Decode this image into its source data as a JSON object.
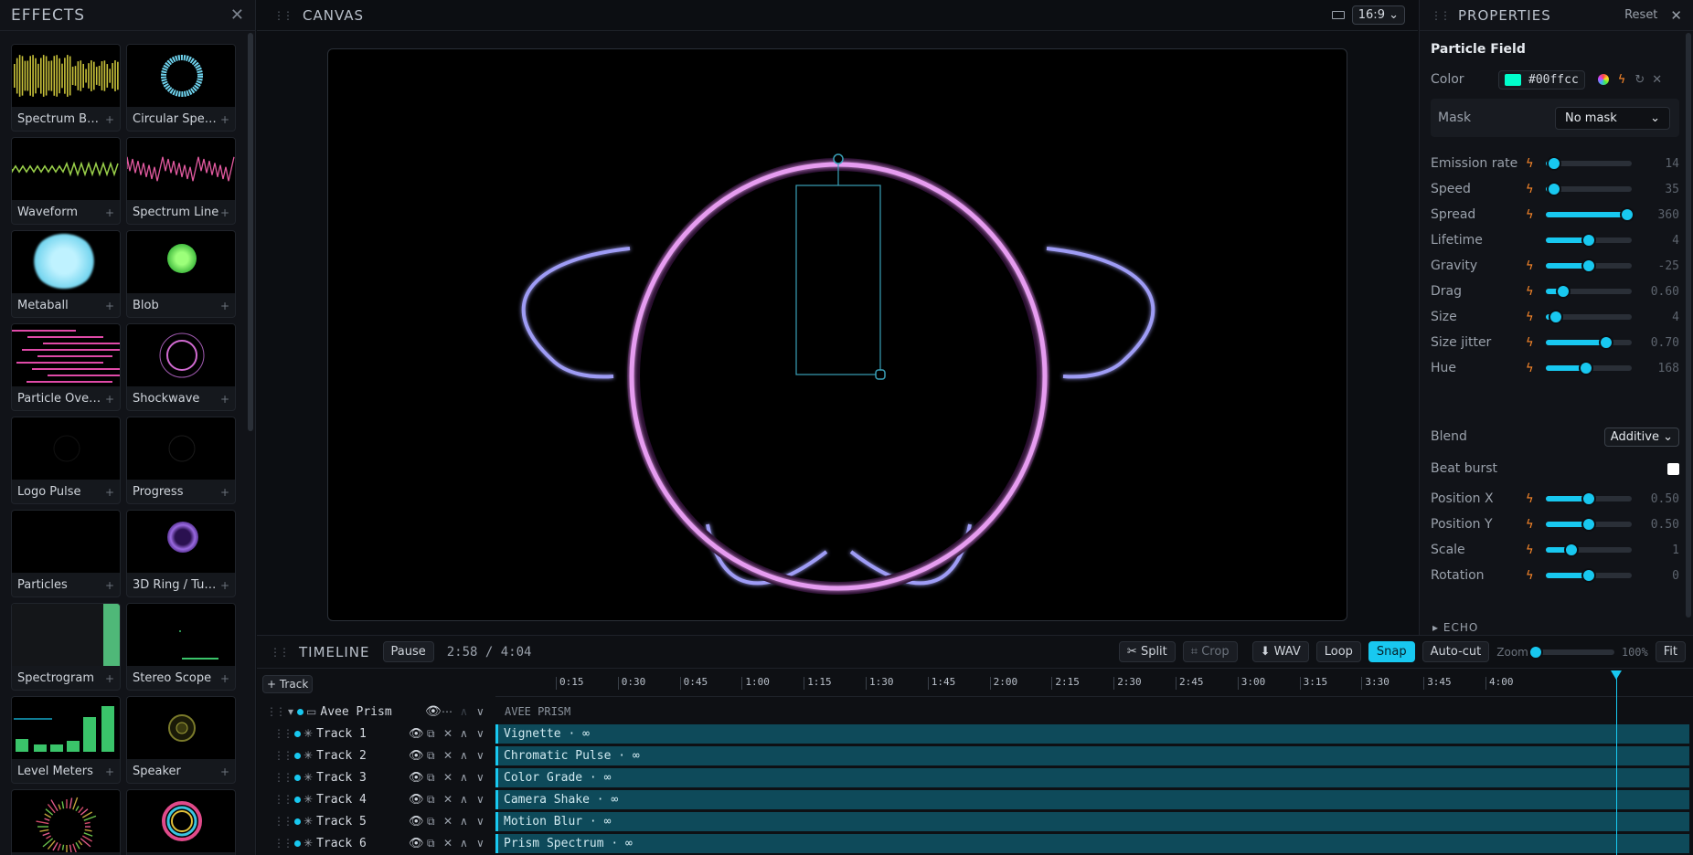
{
  "effects": {
    "title": "EFFECTS",
    "items": [
      {
        "label": "Spectrum Bars",
        "icon": "spectrum-bars-thumb"
      },
      {
        "label": "Circular Spect…",
        "icon": "circular-spectrum-thumb"
      },
      {
        "label": "Waveform",
        "icon": "waveform-thumb"
      },
      {
        "label": "Spectrum Line",
        "icon": "spectrum-line-thumb"
      },
      {
        "label": "Metaball",
        "icon": "metaball-thumb"
      },
      {
        "label": "Blob",
        "icon": "blob-thumb"
      },
      {
        "label": "Particle Overlay",
        "icon": "particle-overlay-thumb"
      },
      {
        "label": "Shockwave",
        "icon": "shockwave-thumb"
      },
      {
        "label": "Logo Pulse",
        "icon": "logo-pulse-thumb"
      },
      {
        "label": "Progress",
        "icon": "progress-thumb"
      },
      {
        "label": "Particles",
        "icon": "particles-thumb"
      },
      {
        "label": "3D Ring / Tun…",
        "icon": "ring-tunnel-thumb"
      },
      {
        "label": "Spectrogram",
        "icon": "spectrogram-thumb"
      },
      {
        "label": "Stereo Scope",
        "icon": "stereo-scope-thumb"
      },
      {
        "label": "Level Meters",
        "icon": "level-meters-thumb"
      },
      {
        "label": "Speaker",
        "icon": "speaker-thumb"
      },
      {
        "label": "",
        "icon": "radial-bars-thumb"
      },
      {
        "label": "",
        "icon": "rainbow-ring-thumb"
      }
    ],
    "add_symbol": "+"
  },
  "canvas": {
    "title": "CANVAS",
    "aspect": "16:9"
  },
  "properties": {
    "title": "PROPERTIES",
    "reset": "Reset",
    "effect_name": "Particle Field",
    "color_label": "Color",
    "color_value": "#00ffcc",
    "mask_label": "Mask",
    "mask_value": "No mask",
    "rows": [
      {
        "label": "Emission rate",
        "value": "14",
        "pos": 0.1,
        "bolt": true
      },
      {
        "label": "Speed",
        "value": "35",
        "pos": 0.1,
        "bolt": true
      },
      {
        "label": "Spread",
        "value": "360",
        "pos": 0.95,
        "bolt": true
      },
      {
        "label": "Lifetime",
        "value": "4",
        "pos": 0.5,
        "bolt": false
      },
      {
        "label": "Gravity",
        "value": "-25",
        "pos": 0.5,
        "bolt": true
      },
      {
        "label": "Drag",
        "value": "0.60",
        "pos": 0.2,
        "bolt": true
      },
      {
        "label": "Size",
        "value": "4",
        "pos": 0.12,
        "bolt": true
      },
      {
        "label": "Size jitter",
        "value": "0.70",
        "pos": 0.7,
        "bolt": true
      },
      {
        "label": "Hue",
        "value": "168",
        "pos": 0.47,
        "bolt": true
      }
    ],
    "blend_label": "Blend",
    "blend_value": "Additive",
    "beat_label": "Beat burst",
    "rows2": [
      {
        "label": "Position X",
        "value": "0.50",
        "pos": 0.5,
        "bolt": true
      },
      {
        "label": "Position Y",
        "value": "0.50",
        "pos": 0.5,
        "bolt": true
      },
      {
        "label": "Scale",
        "value": "1",
        "pos": 0.3,
        "bolt": true
      },
      {
        "label": "Rotation",
        "value": "0",
        "pos": 0.5,
        "bolt": true
      }
    ],
    "echo_label": "ECHO",
    "accent": "#18c8f0",
    "bolt_color": "#ff8a2a"
  },
  "timeline": {
    "title": "TIMELINE",
    "pause": "Pause",
    "time": "2:58 / 4:04",
    "split": "Split",
    "crop": "Crop",
    "wav": "WAV",
    "loop": "Loop",
    "snap": "Snap",
    "autocut": "Auto-cut",
    "zoom_label": "Zoom",
    "zoom_value": "100%",
    "fit": "Fit",
    "add_track": "+ Track",
    "ticks": [
      "0:15",
      "0:30",
      "0:45",
      "1:00",
      "1:15",
      "1:30",
      "1:45",
      "2:00",
      "2:15",
      "2:30",
      "2:45",
      "3:00",
      "3:15",
      "3:30",
      "3:45",
      "4:00"
    ],
    "group": {
      "name": "Avee Prism",
      "label": "AVEE PRISM"
    },
    "tracks": [
      {
        "name": "Track 1",
        "clip": "Vignette · ∞"
      },
      {
        "name": "Track 2",
        "clip": "Chromatic Pulse · ∞"
      },
      {
        "name": "Track 3",
        "clip": "Color Grade · ∞"
      },
      {
        "name": "Track 4",
        "clip": "Camera Shake · ∞"
      },
      {
        "name": "Track 5",
        "clip": "Motion Blur · ∞"
      },
      {
        "name": "Track 6",
        "clip": "Prism Spectrum · ∞"
      }
    ]
  }
}
